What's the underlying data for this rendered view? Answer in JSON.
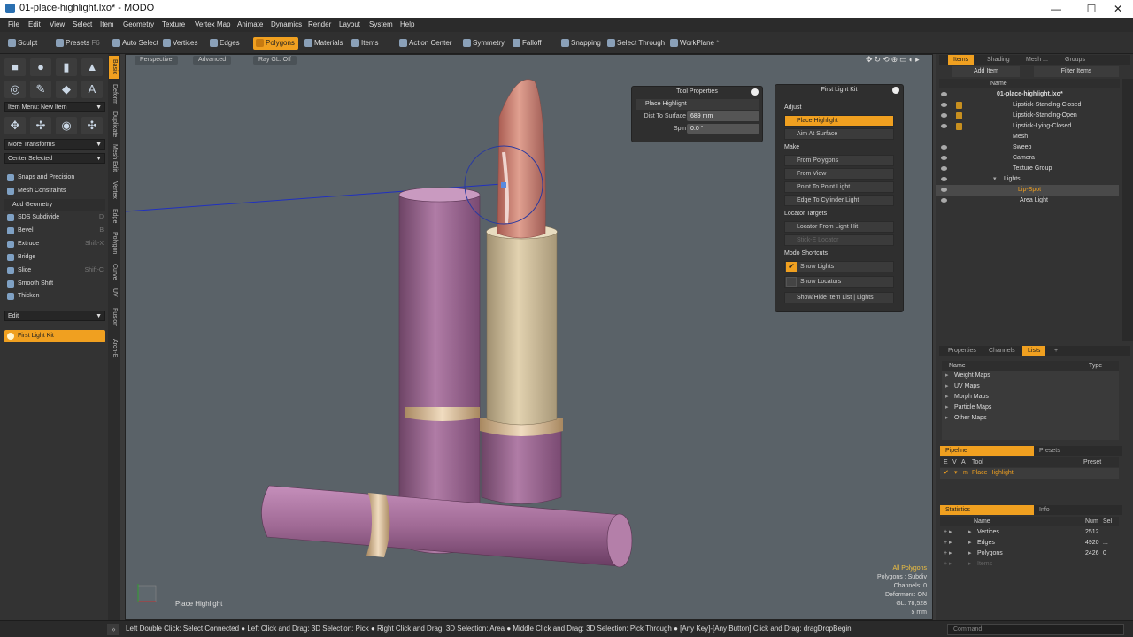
{
  "window": {
    "title": "01-place-highlight.lxo* - MODO",
    "min": "—",
    "max": "☐",
    "close": "✕"
  },
  "menu": [
    "File",
    "Edit",
    "View",
    "Select",
    "Item",
    "Geometry",
    "Texture",
    "Vertex Map",
    "Animate",
    "Dynamics",
    "Render",
    "Layout",
    "System",
    "Help"
  ],
  "toolbar": {
    "sculpt": "Sculpt",
    "presets": "Presets",
    "presets_key": "F6",
    "auto_select": "Auto Select",
    "vertices": "Vertices",
    "edges": "Edges",
    "polygons": "Polygons",
    "materials": "Materials",
    "items": "Items",
    "action_center": "Action Center",
    "symmetry": "Symmetry",
    "falloff": "Falloff",
    "snapping": "Snapping",
    "select_through": "Select Through",
    "workplane": "WorkPlane"
  },
  "left": {
    "item_menu": "Item Menu: New Item",
    "more_transforms": "More Transforms",
    "center_selected": "Center Selected",
    "snaps": "Snaps and Precision",
    "mesh_constraints": "Mesh Constraints",
    "add_geometry": "Add Geometry",
    "tools": [
      {
        "label": "SDS Subdivide",
        "key": "D"
      },
      {
        "label": "Bevel",
        "key": "B"
      },
      {
        "label": "Extrude",
        "key": "Shift-X"
      },
      {
        "label": "Bridge",
        "key": ""
      },
      {
        "label": "Slice",
        "key": "Shift-C"
      },
      {
        "label": "Smooth Shift",
        "key": ""
      },
      {
        "label": "Thicken",
        "key": ""
      }
    ],
    "edit": "Edit",
    "first_light_kit": "First Light Kit"
  },
  "vtabs": [
    "Basic",
    "Deform",
    "Duplicate",
    "Mesh Edit",
    "Vertex",
    "Edge",
    "Polygon",
    "Curve",
    "UV",
    "Fusion",
    "Arch-E"
  ],
  "viewport": {
    "perspective": "Perspective",
    "advanced": "Advanced",
    "raygl": "Ray GL: Off",
    "tool_label": "Place Highlight",
    "info": [
      "All Polygons",
      "Polygons : Subdiv",
      "Channels: 0",
      "Deformers: ON",
      "GL: 78,528",
      "5 mm"
    ]
  },
  "tool_props": {
    "title": "Tool Properties",
    "tool": "Place Highlight",
    "dist_label": "Dist To Surface",
    "dist_value": "689 mm",
    "spin_label": "Spin",
    "spin_value": "0.0 °"
  },
  "flk": {
    "title": "First Light Kit",
    "adjust": "Adjust",
    "place_highlight": "Place Highlight",
    "aim_at_surface": "Aim At Surface",
    "make": "Make",
    "from_polygons": "From Polygons",
    "from_view": "From View",
    "point_to_point": "Point To Point Light",
    "edge_to_cylinder": "Edge To Cylinder Light",
    "locator_targets": "Locator Targets",
    "locator_from_light": "Locator From Light Hit",
    "stick_e_locator": "Stick-E Locator",
    "modo_shortcuts": "Modo Shortcuts",
    "show_lights": "Show Lights",
    "show_locators": "Show Locators",
    "show_hide": "Show/Hide Item List | Lights"
  },
  "items_panel": {
    "tabs": [
      "Items",
      "Shading",
      "Mesh ...",
      "Groups"
    ],
    "add_item": "Add Item",
    "filter": "Filter Items",
    "col_name": "Name",
    "rows": [
      "01-place-highlight.lxo*",
      "Lipstick-Standing-Closed",
      "Lipstick-Standing-Open",
      "Lipstick-Lying-Closed",
      "Mesh",
      "Sweep",
      "Camera",
      "Texture Group",
      "Lights",
      "Lip-Spot",
      "Area Light"
    ]
  },
  "lists_panel": {
    "tabs": [
      "Properties",
      "Channels",
      "Lists",
      "+"
    ],
    "col_name": "Name",
    "col_type": "Type",
    "rows": [
      "Weight Maps",
      "UV Maps",
      "Morph Maps",
      "Particle Maps",
      "Other Maps"
    ]
  },
  "pipeline": {
    "tabs": [
      "Pipeline",
      "Presets"
    ],
    "cols": [
      "E",
      "V",
      "A",
      "Tool",
      "Preset"
    ],
    "row_tool": "Place Highlight",
    "row_m": "m"
  },
  "stats": {
    "tabs": [
      "Statistics",
      "Info"
    ],
    "cols": [
      "Name",
      "Num",
      "Sel"
    ],
    "rows": [
      {
        "name": "Vertices",
        "num": "2512",
        "sel": "..."
      },
      {
        "name": "Edges",
        "num": "4920",
        "sel": "..."
      },
      {
        "name": "Polygons",
        "num": "2426",
        "sel": "0"
      },
      {
        "name": "Items",
        "num": "",
        "sel": ""
      }
    ]
  },
  "status": {
    "text": "Left Double Click: Select Connected ● Left Click and Drag: 3D Selection: Pick ● Right Click and Drag: 3D Selection: Area ● Middle Click and Drag: 3D Selection: Pick Through ● [Any Key]-[Any Button] Click and Drag: dragDropBegin",
    "command": "Command"
  }
}
